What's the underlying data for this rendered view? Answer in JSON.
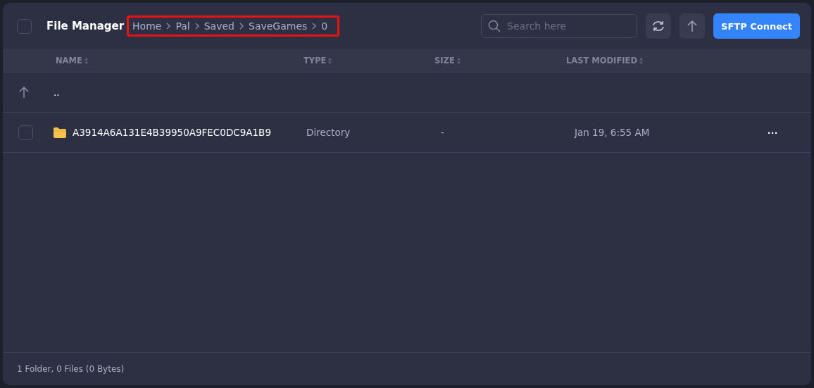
{
  "header": {
    "select_all": {
      "checked": false
    },
    "title": "File Manager",
    "breadcrumb": [
      "Home",
      "Pal",
      "Saved",
      "SaveGames",
      "0"
    ],
    "breadcrumb_highlighted": true,
    "search": {
      "placeholder": "Search here"
    },
    "connect_button": "SFTP Connect"
  },
  "table": {
    "columns": [
      "NAME",
      "TYPE",
      "SIZE",
      "LAST MODIFIED"
    ],
    "rows": [
      {
        "kind": "parent",
        "name": ".."
      },
      {
        "kind": "folder",
        "checked": false,
        "name": "A3914A6A131E4B39950A9FEC0DC9A1B9",
        "type": "Directory",
        "size": "-",
        "modified": "Jan 19, 6:55 AM",
        "menu": "···"
      }
    ]
  },
  "status_bar": "1 Folder, 0 Files (0 Bytes)"
}
